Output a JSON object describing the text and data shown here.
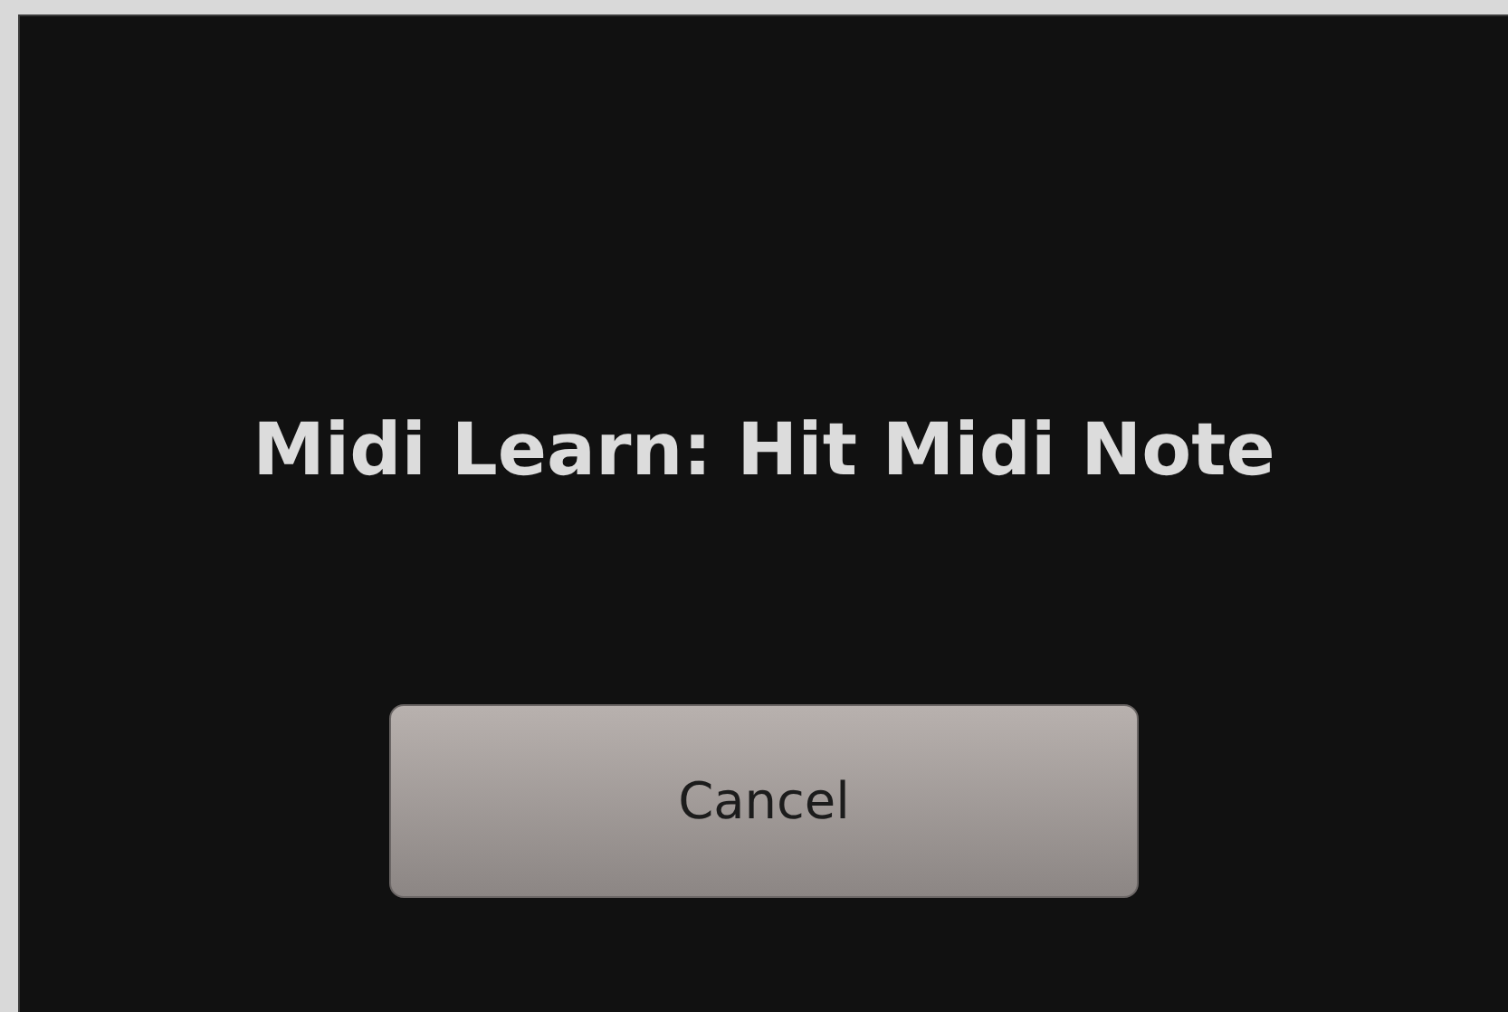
{
  "dialog": {
    "message": "Midi Learn: Hit Midi Note",
    "buttons": [
      "Cancel"
    ]
  }
}
